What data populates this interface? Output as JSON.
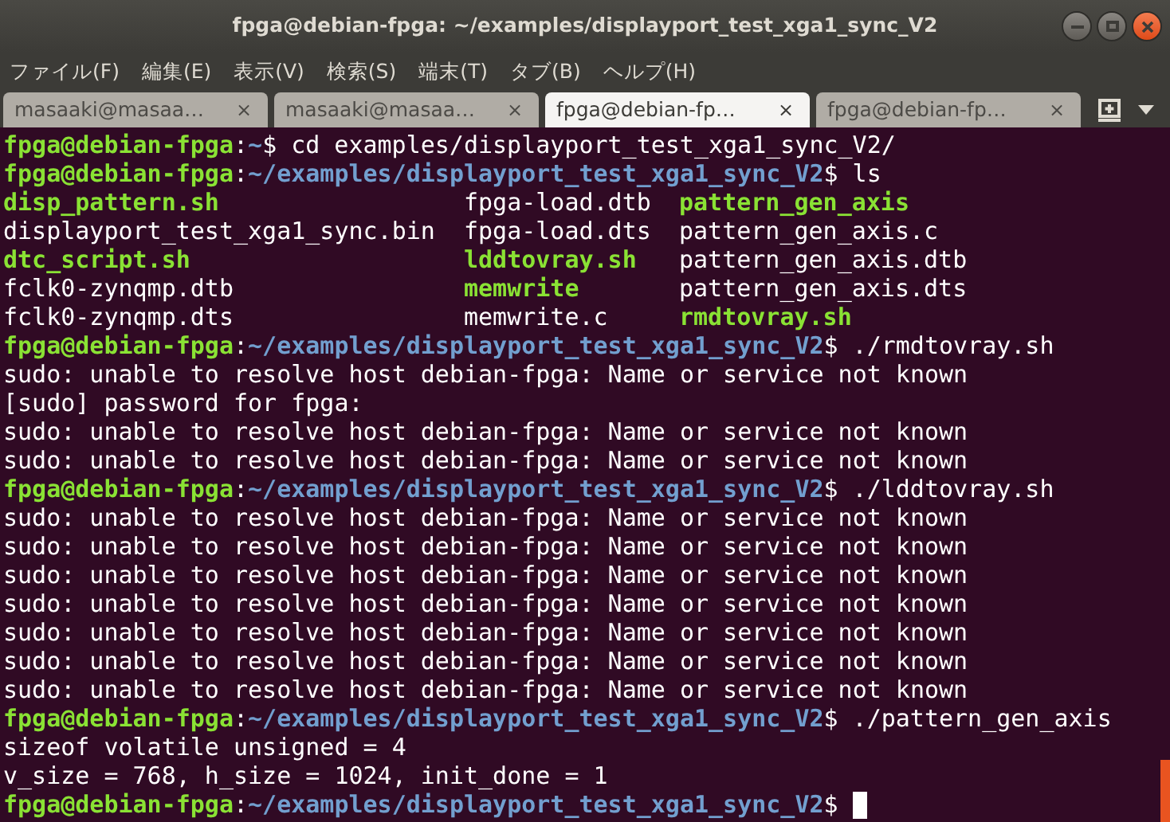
{
  "window": {
    "title": "fpga@debian-fpga: ~/examples/displayport_test_xga1_sync_V2"
  },
  "menu": [
    "ファイル(F)",
    "編集(E)",
    "表示(V)",
    "検索(S)",
    "端末(T)",
    "タブ(B)",
    "ヘルプ(H)"
  ],
  "tabs": [
    {
      "label": "masaaki@masaa…",
      "close": "×",
      "selected": false
    },
    {
      "label": "masaaki@masaa…",
      "close": "×",
      "selected": false
    },
    {
      "label": "fpga@debian-fp…",
      "close": "×",
      "selected": true
    },
    {
      "label": "fpga@debian-fp…",
      "close": "×",
      "selected": false
    }
  ],
  "terminal": [
    {
      "kind": "prompt",
      "user": "fpga@debian-fpga",
      "sep": ":",
      "path": "~",
      "symbol": "$",
      "command": "cd examples/displayport_test_xga1_sync_V2/",
      "cursor": false
    },
    {
      "kind": "prompt",
      "user": "fpga@debian-fpga",
      "sep": ":",
      "path": "~/examples/displayport_test_xga1_sync_V2",
      "symbol": "$",
      "command": "ls",
      "cursor": false
    },
    {
      "kind": "listing",
      "entries": [
        {
          "name": "disp_pattern.sh",
          "executable": true
        },
        {
          "name": "fpga-load.dtb",
          "executable": false
        },
        {
          "name": "pattern_gen_axis",
          "executable": true
        }
      ]
    },
    {
      "kind": "listing",
      "entries": [
        {
          "name": "displayport_test_xga1_sync.bin",
          "executable": false
        },
        {
          "name": "fpga-load.dts",
          "executable": false
        },
        {
          "name": "pattern_gen_axis.c",
          "executable": false
        }
      ]
    },
    {
      "kind": "listing",
      "entries": [
        {
          "name": "dtc_script.sh",
          "executable": true
        },
        {
          "name": "lddtovray.sh",
          "executable": true
        },
        {
          "name": "pattern_gen_axis.dtb",
          "executable": false
        }
      ]
    },
    {
      "kind": "listing",
      "entries": [
        {
          "name": "fclk0-zynqmp.dtb",
          "executable": false
        },
        {
          "name": "memwrite",
          "executable": true
        },
        {
          "name": "pattern_gen_axis.dts",
          "executable": false
        }
      ]
    },
    {
      "kind": "listing",
      "entries": [
        {
          "name": "fclk0-zynqmp.dts",
          "executable": false
        },
        {
          "name": "memwrite.c",
          "executable": false
        },
        {
          "name": "rmdtovray.sh",
          "executable": true
        }
      ]
    },
    {
      "kind": "prompt",
      "user": "fpga@debian-fpga",
      "sep": ":",
      "path": "~/examples/displayport_test_xga1_sync_V2",
      "symbol": "$",
      "command": "./rmdtovray.sh",
      "cursor": false
    },
    {
      "kind": "output",
      "text": "sudo: unable to resolve host debian-fpga: Name or service not known"
    },
    {
      "kind": "output",
      "text": "[sudo] password for fpga:"
    },
    {
      "kind": "output",
      "text": "sudo: unable to resolve host debian-fpga: Name or service not known"
    },
    {
      "kind": "output",
      "text": "sudo: unable to resolve host debian-fpga: Name or service not known"
    },
    {
      "kind": "prompt",
      "user": "fpga@debian-fpga",
      "sep": ":",
      "path": "~/examples/displayport_test_xga1_sync_V2",
      "symbol": "$",
      "command": "./lddtovray.sh",
      "cursor": false
    },
    {
      "kind": "output",
      "text": "sudo: unable to resolve host debian-fpga: Name or service not known"
    },
    {
      "kind": "output",
      "text": "sudo: unable to resolve host debian-fpga: Name or service not known"
    },
    {
      "kind": "output",
      "text": "sudo: unable to resolve host debian-fpga: Name or service not known"
    },
    {
      "kind": "output",
      "text": "sudo: unable to resolve host debian-fpga: Name or service not known"
    },
    {
      "kind": "output",
      "text": "sudo: unable to resolve host debian-fpga: Name or service not known"
    },
    {
      "kind": "output",
      "text": "sudo: unable to resolve host debian-fpga: Name or service not known"
    },
    {
      "kind": "output",
      "text": "sudo: unable to resolve host debian-fpga: Name or service not known"
    },
    {
      "kind": "prompt",
      "user": "fpga@debian-fpga",
      "sep": ":",
      "path": "~/examples/displayport_test_xga1_sync_V2",
      "symbol": "$",
      "command": "./pattern_gen_axis",
      "cursor": false
    },
    {
      "kind": "output",
      "text": "sizeof volatile unsigned = 4"
    },
    {
      "kind": "output",
      "text": "v_size = 768, h_size = 1024, init_done = 1"
    },
    {
      "kind": "prompt",
      "user": "fpga@debian-fpga",
      "sep": ":",
      "path": "~/examples/displayport_test_xga1_sync_V2",
      "symbol": "$",
      "cursor": true
    }
  ]
}
